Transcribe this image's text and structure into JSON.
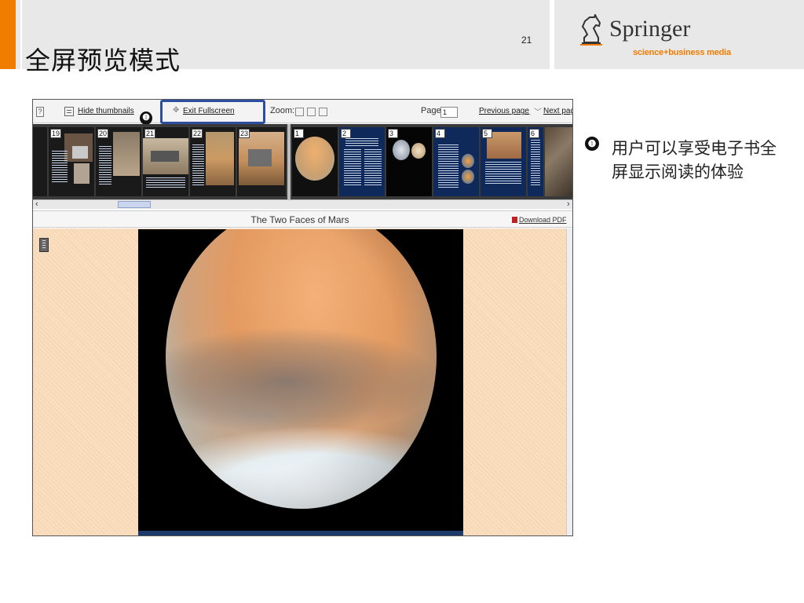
{
  "slide": {
    "title": "全屏预览模式",
    "page_number": "21",
    "accent_color": "#f07d00"
  },
  "logo": {
    "name": "Springer",
    "tagline": "science+business media",
    "icon": "knight-horse-icon"
  },
  "viewer": {
    "toolbar": {
      "help_label": "?",
      "hide_thumbnails": "Hide thumbnails",
      "exit_fullscreen": "Exit Fullscreen",
      "highlight_badge": "❶",
      "zoom_label": "Zoom:",
      "page_label": "Page",
      "page_value": "1",
      "previous_page": "Previous page",
      "next_page": "Next page"
    },
    "thumbnails_previous": [
      "19",
      "20",
      "21",
      "22",
      "23"
    ],
    "thumbnails_current": [
      "1",
      "2",
      "3",
      "4",
      "5",
      "6"
    ],
    "document_title": "The Two Faces of Mars",
    "download_pdf": "Download PDF",
    "highlight_color": "#2e4ea0"
  },
  "note": {
    "badge": "❶",
    "text": "用户可以享受电子书全屏显示阅读的体验"
  }
}
